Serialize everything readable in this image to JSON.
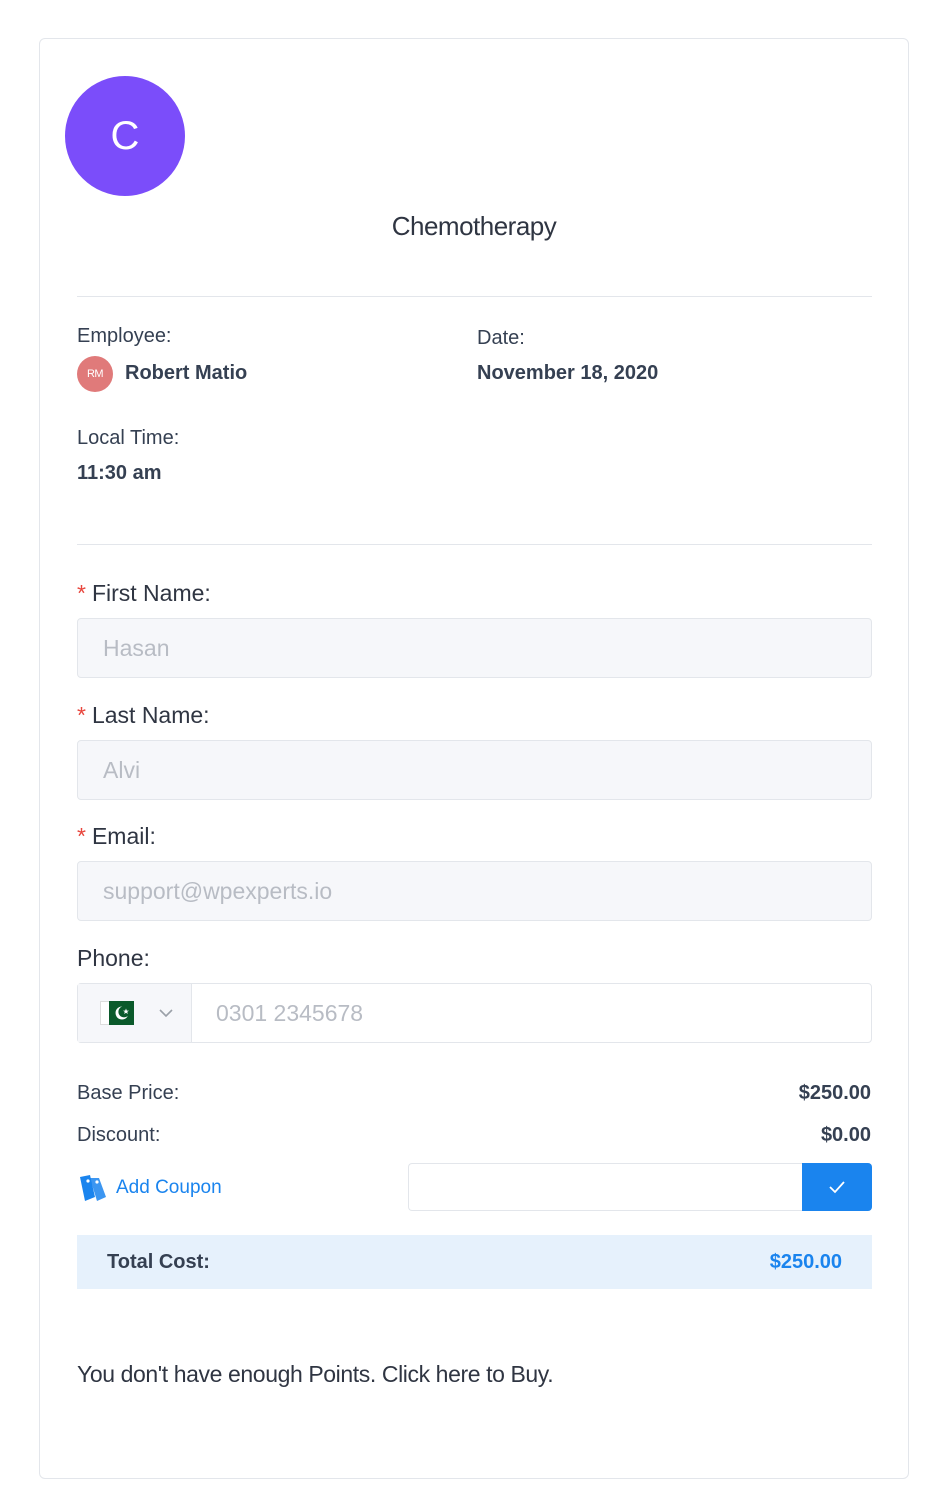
{
  "service": {
    "avatar_letter": "C",
    "avatar_color": "#7b4dfa",
    "title": "Chemotherapy"
  },
  "info": {
    "employee_label": "Employee:",
    "employee_initials": "RM",
    "employee_name": "Robert Matio",
    "date_label": "Date:",
    "date_value": "November 18, 2020",
    "time_label": "Local Time:",
    "time_value": "11:30 am"
  },
  "form": {
    "required_mark": "*",
    "first_name_label": "First Name:",
    "first_name_placeholder": "Hasan",
    "last_name_label": "Last Name:",
    "last_name_placeholder": "Alvi",
    "email_label": "Email:",
    "email_placeholder": "support@wpexperts.io",
    "phone_label": "Phone:",
    "phone_country_icon": "pakistan-flag-icon",
    "phone_placeholder": "0301 2345678"
  },
  "pricing": {
    "base_label": "Base Price:",
    "base_value": "$250.00",
    "discount_label": "Discount:",
    "discount_value": "$0.00",
    "coupon_label": "Add Coupon",
    "coupon_input_value": "",
    "total_label": "Total Cost:",
    "total_value": "$250.00"
  },
  "points_message": "You don't have enough Points. Click here to Buy.",
  "colors": {
    "accent": "#1a84ee",
    "required": "#e8463d",
    "total_bg": "#e6f1fc"
  }
}
